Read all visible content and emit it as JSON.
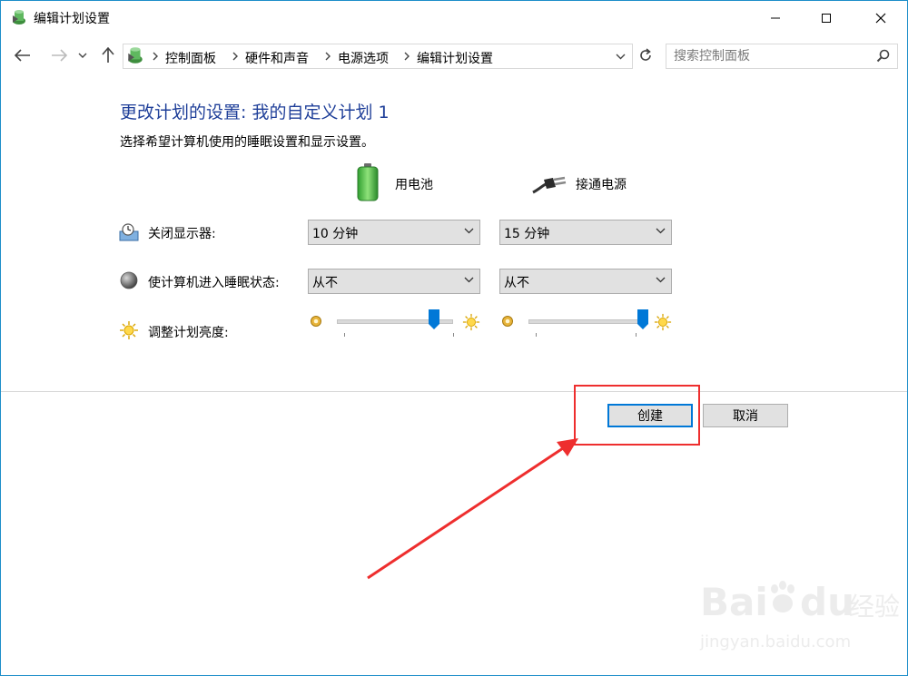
{
  "window": {
    "title": "编辑计划设置"
  },
  "titlebar_buttons": {
    "minimize_icon": "minimize-icon",
    "maximize_icon": "maximize-icon",
    "close_icon": "close-icon"
  },
  "address": {
    "crumbs": [
      "控制面板",
      "硬件和声音",
      "电源选项",
      "编辑计划设置"
    ]
  },
  "search": {
    "placeholder": "搜索控制面板"
  },
  "content": {
    "heading": "更改计划的设置: 我的自定义计划 1",
    "subtitle": "选择希望计算机使用的睡眠设置和显示设置。",
    "columns": {
      "battery": "用电池",
      "plugged": "接通电源"
    },
    "rows": {
      "display_off": {
        "label": "关闭显示器:",
        "battery": "10 分钟",
        "plugged": "15 分钟"
      },
      "sleep": {
        "label": "使计算机进入睡眠状态:",
        "battery": "从不",
        "plugged": "从不"
      },
      "brightness": {
        "label": "调整计划亮度:",
        "battery_level": 0.85,
        "plugged_level": 1.0
      }
    }
  },
  "buttons": {
    "create": "创建",
    "cancel": "取消"
  },
  "watermark": {
    "brand": "Bai",
    "brand2": "du",
    "suffix": "经验",
    "url": "jingyan.baidu.com"
  },
  "colors": {
    "heading": "#1f3f99",
    "accent": "#0078d7",
    "callout": "#ee2e2e"
  }
}
